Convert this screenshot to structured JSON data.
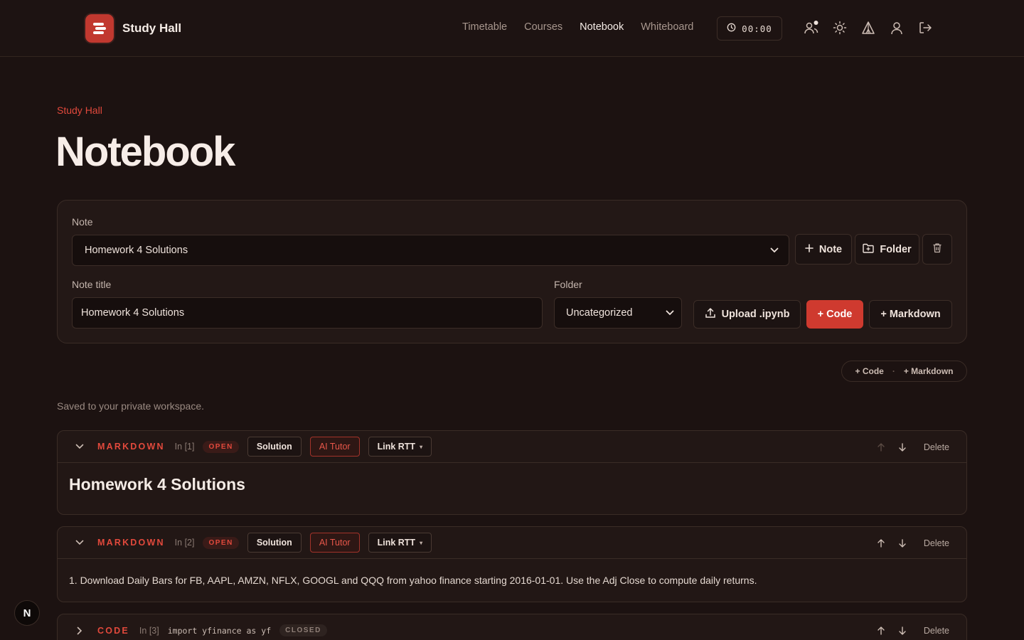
{
  "app": {
    "name": "Study Hall"
  },
  "nav": {
    "links": [
      "Timetable",
      "Courses",
      "Notebook",
      "Whiteboard"
    ],
    "active": "Notebook",
    "timer": "00:00",
    "icons": [
      "users-icon",
      "sun-icon",
      "tent-icon",
      "user-icon",
      "logout-icon"
    ]
  },
  "header": {
    "breadcrumb": "Study Hall",
    "title": "Notebook"
  },
  "panel": {
    "note_label": "Note",
    "note_selected": "Homework 4 Solutions",
    "add_note_label": "Note",
    "add_folder_label": "Folder",
    "title_label": "Note title",
    "title_value": "Homework 4 Solutions",
    "folder_label": "Folder",
    "folder_selected": "Uncategorized",
    "upload_label": "Upload .ipynb",
    "add_code_label": "+ Code",
    "add_markdown_label": "+ Markdown"
  },
  "quick_add": {
    "code": "+ Code",
    "sep": "·",
    "markdown": "+ Markdown"
  },
  "status": "Saved to your private workspace.",
  "cells": [
    {
      "type": "MARKDOWN",
      "count": "In [1]",
      "state": "OPEN",
      "solution": "Solution",
      "tutor": "AI Tutor",
      "link": "Link RTT",
      "content": "Homework 4 Solutions",
      "delete": "Delete"
    },
    {
      "type": "MARKDOWN",
      "count": "In [2]",
      "state": "OPEN",
      "solution": "Solution",
      "tutor": "AI Tutor",
      "link": "Link RTT",
      "content": "1. Download Daily Bars for FB, AAPL, AMZN, NFLX, GOOGL and QQQ from yahoo finance starting 2016-01-01. Use the Adj Close to compute daily returns.",
      "delete": "Delete"
    },
    {
      "type": "CODE",
      "count": "In [3]",
      "preview": "import yfinance as yf",
      "state": "CLOSED",
      "delete": "Delete"
    }
  ],
  "dev_badge": "N",
  "colors": {
    "accent": "#e2493c",
    "background": "#1c1211",
    "panel": "#231816"
  }
}
